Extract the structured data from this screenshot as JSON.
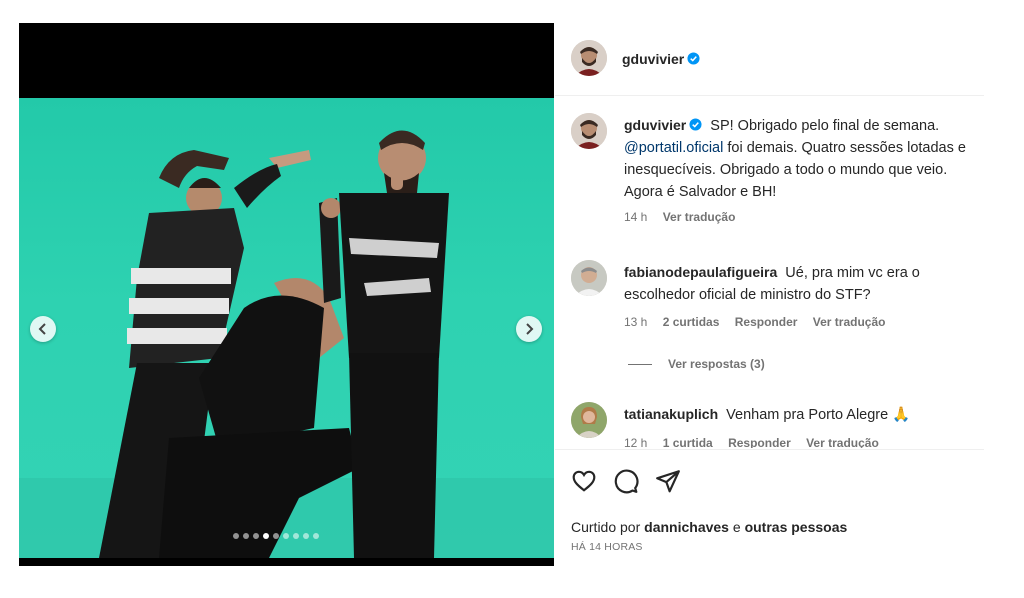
{
  "post": {
    "author": "gduvivier",
    "verified": true,
    "carousel": {
      "count": 9,
      "active_index": 3
    }
  },
  "caption": {
    "username": "gduvivier",
    "text_before": "SP! Obrigado pelo final de semana. ",
    "mention": "@portatil.oficial",
    "text_after": " foi demais. Quatro sessões lotadas e inesquecíveis. Obrigado a todo o mundo que veio. Agora é Salvador e BH!",
    "time": "14 h",
    "translate": "Ver tradução"
  },
  "comments": [
    {
      "username": "fabianodepaulafigueira",
      "text": "Ué, pra mim vc era o escolhedor oficial de ministro do STF?",
      "time": "13 h",
      "likes": "2 curtidas",
      "reply": "Responder",
      "translate": "Ver tradução",
      "view_replies": "Ver respostas (3)"
    },
    {
      "username": "tatianakuplich",
      "text": "Venham pra Porto Alegre",
      "emoji": "🙏",
      "time": "12 h",
      "likes": "1 curtida",
      "reply": "Responder",
      "translate": "Ver tradução"
    }
  ],
  "footer": {
    "liked_prefix": "Curtido por ",
    "liked_user": "dannichaves",
    "liked_mid": " e ",
    "liked_others": "outras pessoas",
    "time_ago": "HÁ 14 HORAS"
  },
  "icons": {
    "like": "heart-icon",
    "comment": "comment-icon",
    "share": "share-icon",
    "verified": "verified-badge-icon",
    "prev": "chevron-left-icon",
    "next": "chevron-right-icon"
  },
  "colors": {
    "backdrop": "#2ed2b1",
    "verified": "#0095f6",
    "mention": "#00376b",
    "secondary_text": "#737373"
  }
}
